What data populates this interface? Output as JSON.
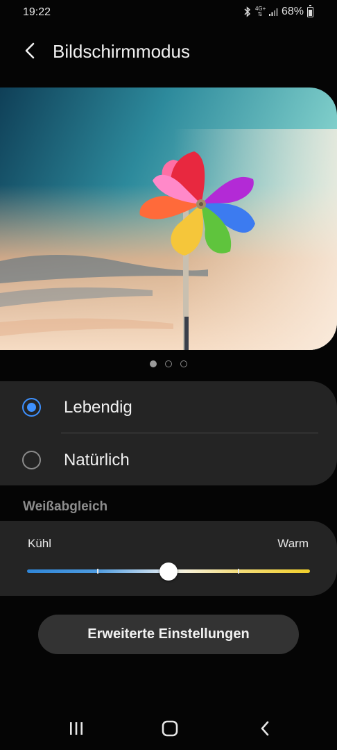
{
  "status_bar": {
    "time": "19:22",
    "network": "4G+",
    "battery": "68%",
    "icons": [
      "bluetooth-icon",
      "network-4g-icon",
      "signal-icon",
      "battery-icon"
    ]
  },
  "header": {
    "title": "Bildschirmmodus",
    "back_icon": "back-arrow-icon"
  },
  "preview": {
    "image": "pinwheel-sky-photo",
    "page_count": 3,
    "current_page": 1
  },
  "modes": [
    {
      "label": "Lebendig",
      "selected": true
    },
    {
      "label": "Natürlich",
      "selected": false
    }
  ],
  "white_balance": {
    "section_label": "Weißabgleich",
    "cool_label": "Kühl",
    "warm_label": "Warm",
    "value_fraction": 0.5,
    "steps": 5
  },
  "advanced_button": {
    "label": "Erweiterte Einstellungen"
  },
  "nav_bar": {
    "icons": [
      "recent-apps-icon",
      "home-icon",
      "back-icon"
    ]
  },
  "colors": {
    "accent": "#3e91ff",
    "card": "#242424",
    "background": "#050505"
  }
}
